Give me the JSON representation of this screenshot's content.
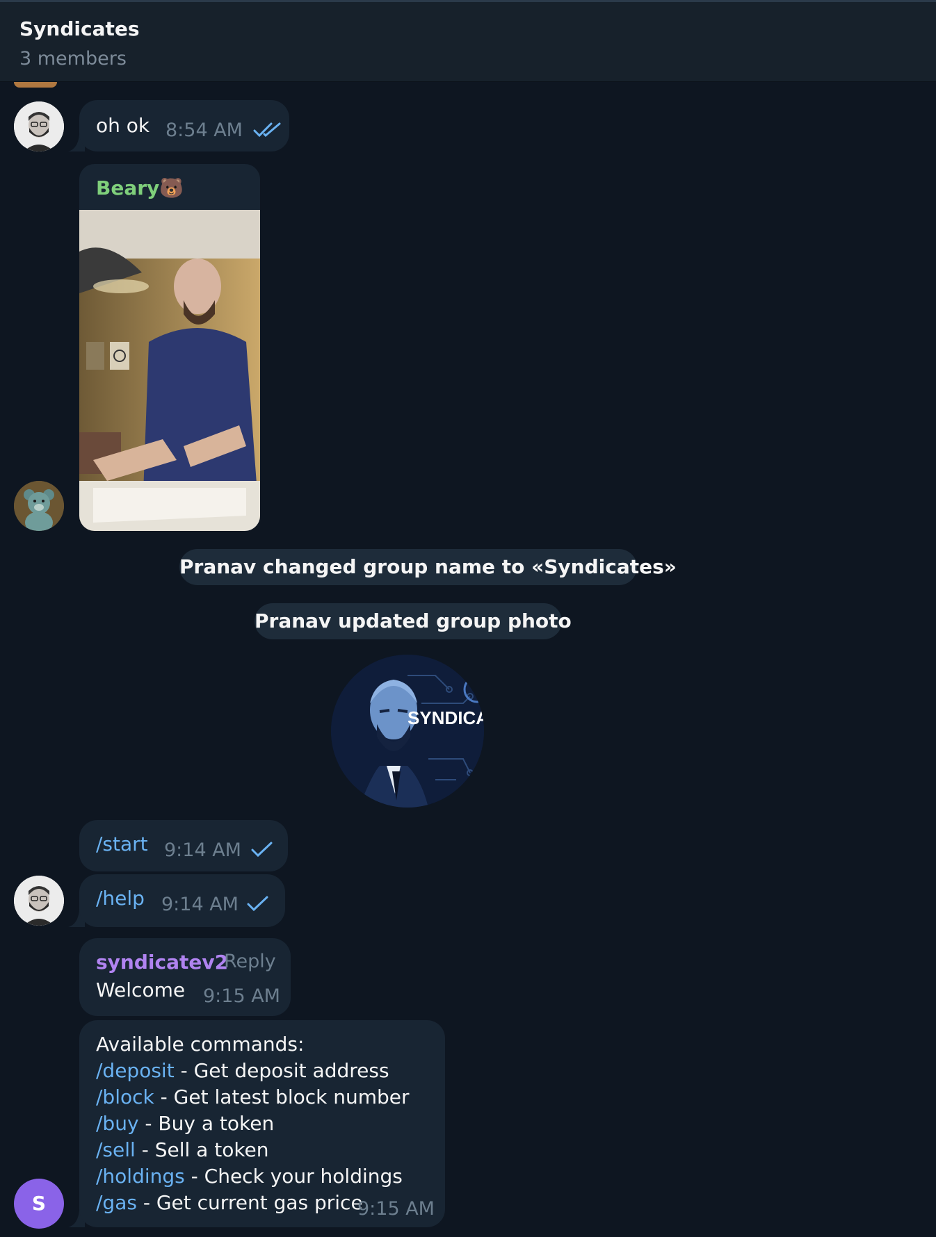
{
  "header": {
    "title": "Syndicates",
    "subtitle": "3 members"
  },
  "messages": {
    "oh_ok": {
      "text": "oh ok",
      "time": "8:54 AM"
    },
    "beary": {
      "sender": "Beary",
      "sender_emoji": "🐻"
    },
    "service1": "Pranav changed group name to «Syndicates»",
    "service2": "Pranav updated group photo",
    "group_photo_text": "SYNDICA",
    "start": {
      "text": "/start",
      "time": "9:14 AM"
    },
    "help": {
      "text": "/help",
      "time": "9:14 AM"
    },
    "welcome": {
      "sender": "syndicatev2",
      "reply_label": "Reply",
      "text": "Welcome",
      "time": "9:15 AM"
    },
    "commands": {
      "intro": "Available commands:",
      "items": [
        {
          "cmd": "/deposit",
          "desc": " - Get deposit address"
        },
        {
          "cmd": "/block",
          "desc": " - Get latest block number"
        },
        {
          "cmd": "/buy",
          "desc": " - Buy a token"
        },
        {
          "cmd": "/sell",
          "desc": " - Sell a token"
        },
        {
          "cmd": "/holdings",
          "desc": " - Check your holdings"
        },
        {
          "cmd": "/gas",
          "desc": " - Get current gas price"
        }
      ],
      "time": "9:15 AM"
    },
    "bot_avatar_letter": "S"
  },
  "colors": {
    "background": "#0e1621",
    "bubble": "#182533",
    "accent_link": "#6ab2f2",
    "beary_name": "#7fcf7b",
    "bot_name": "#b083f0",
    "bot_avatar": "#8a63e8"
  }
}
